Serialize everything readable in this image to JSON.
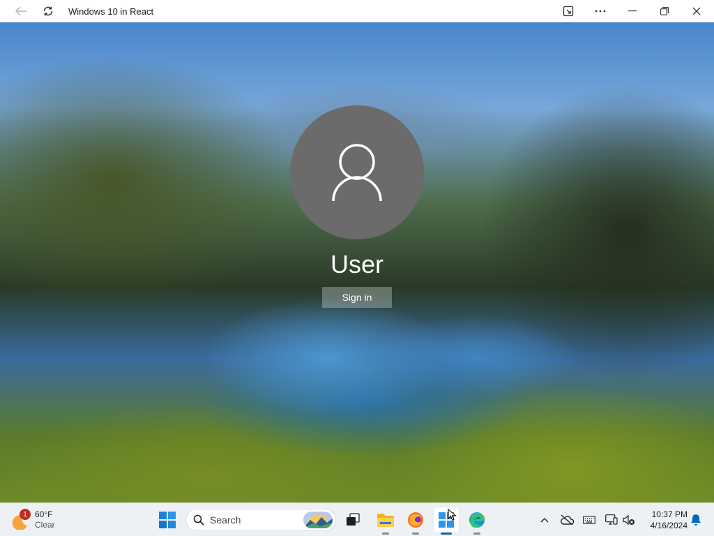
{
  "window": {
    "title": "Windows 10 in React",
    "icons": [
      "back-arrow-icon",
      "refresh-icon",
      "install-app-icon",
      "more-icon",
      "minimize-icon",
      "restore-icon",
      "close-icon"
    ]
  },
  "lock_screen": {
    "username": "User",
    "signin_label": "Sign in"
  },
  "taskbar": {
    "weather": {
      "temperature": "60°F",
      "condition": "Clear",
      "badge": "1"
    },
    "search_placeholder": "Search",
    "apps": [
      "start-button",
      "task-view",
      "file-explorer",
      "firefox",
      "windows-store",
      "edge"
    ],
    "active_app": "windows-store",
    "tray": [
      "show-hidden-icons",
      "onedrive",
      "keyboard",
      "display",
      "volume-muted"
    ],
    "clock": {
      "time": "10:37 PM",
      "date": "4/16/2024"
    }
  },
  "colors": {
    "accent": "#0067c0",
    "avatar_bg": "#6b6b6b",
    "notification_badge": "#c42b1c"
  }
}
